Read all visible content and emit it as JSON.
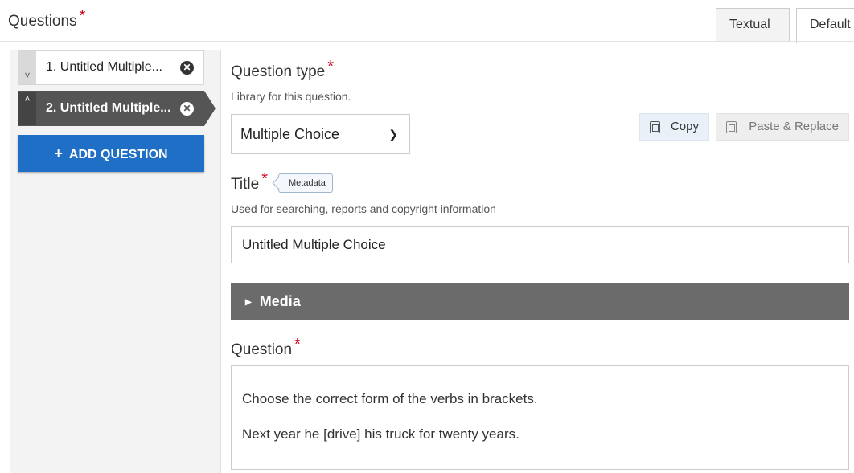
{
  "header": {
    "title": "Questions",
    "required_mark": "*",
    "tabs": [
      {
        "label": "Textual"
      },
      {
        "label": "Default"
      }
    ]
  },
  "sidebar": {
    "questions": [
      {
        "label": "1. Untitled Multiple...",
        "handle_icon": "˅",
        "selected": false
      },
      {
        "label": "2. Untitled Multiple...",
        "handle_icon": "˄",
        "selected": true
      }
    ],
    "add_button": {
      "icon": "+",
      "label": "ADD QUESTION"
    }
  },
  "editor": {
    "question_type": {
      "label": "Question type",
      "required_mark": "*",
      "help": "Library for this question.",
      "value": "Multiple Choice"
    },
    "copy_button": {
      "label": "Copy"
    },
    "paste_button": {
      "label": "Paste & Replace"
    },
    "title": {
      "label": "Title",
      "required_mark": "*",
      "tag": "Metadata",
      "help": "Used for searching, reports and copyright information",
      "value": "Untitled Multiple Choice"
    },
    "media": {
      "label": "Media"
    },
    "question": {
      "label": "Question",
      "required_mark": "*",
      "lines": [
        "Choose the correct form of the verbs in brackets.",
        "Next year he [drive] his truck for twenty years."
      ]
    }
  },
  "colors": {
    "accent_blue": "#1e6fc5",
    "selected_dark": "#555555",
    "media_bar": "#6b6b6b",
    "required_red": "#d0021b"
  }
}
